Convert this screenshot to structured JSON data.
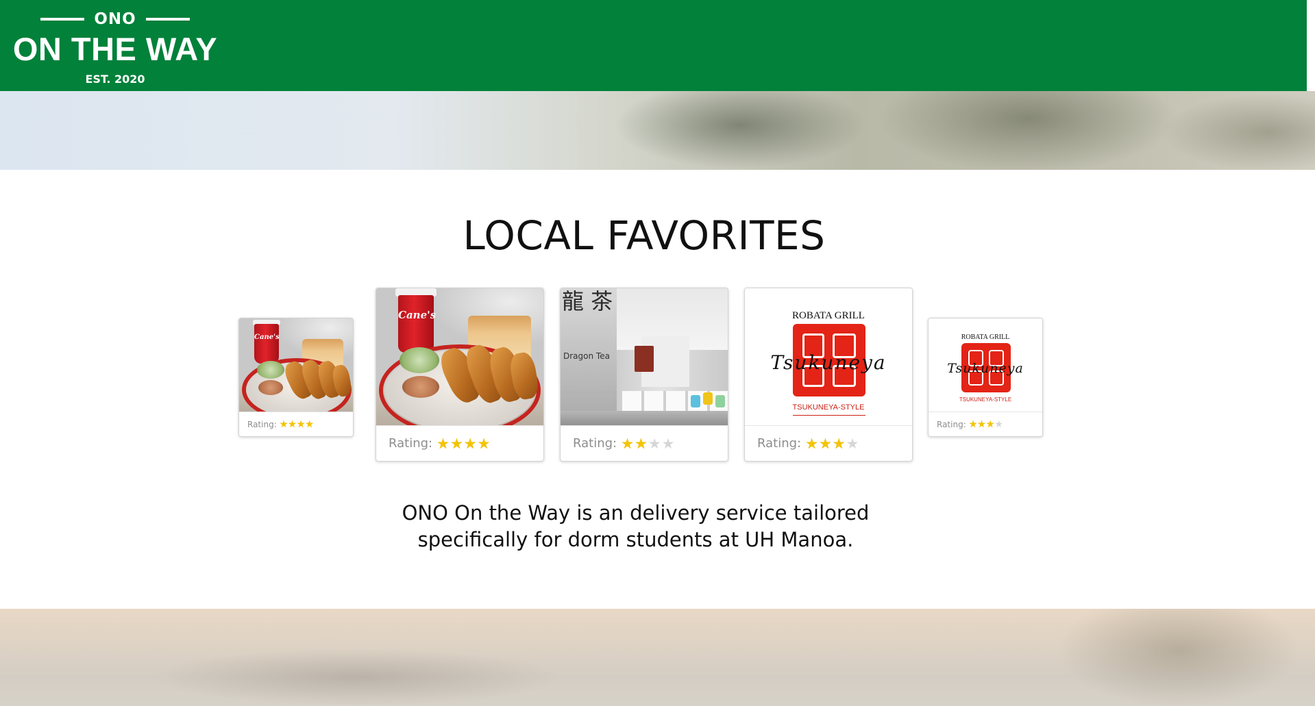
{
  "header": {
    "logo_top": "ONO",
    "logo_main": "ON THE WAY",
    "logo_est": "EST. 2020",
    "background": "#01813a"
  },
  "main": {
    "title": "LOCAL FAVORITES",
    "tagline_line1": "ONO On the Way is an delivery service tailored",
    "tagline_line2": "specifically for dorm students at UH Manoa."
  },
  "carousel": {
    "rating_label": "Rating:",
    "cards": [
      {
        "restaurant": "Raising Cane's",
        "image": "canes-food-photo",
        "cup_text": "Cane's",
        "rating": 4,
        "max": 4,
        "size": "small"
      },
      {
        "restaurant": "Raising Cane's",
        "image": "canes-food-photo",
        "cup_text": "Cane's",
        "rating": 4,
        "max": 4,
        "size": "big"
      },
      {
        "restaurant": "Dragon Tea",
        "image": "dragon-tea-interior",
        "kanji": "龍 茶",
        "brand_text": "Dragon Tea",
        "rating": 2,
        "max": 4,
        "size": "big"
      },
      {
        "restaurant": "Tsukuneya",
        "image": "tsukuneya-logo",
        "top_text": "ROBATA GRILL",
        "script_text": "Tsukuneya",
        "bottom_text": "TSUKUNEYA-STYLE",
        "rating": 3,
        "max": 4,
        "size": "big"
      },
      {
        "restaurant": "Tsukuneya",
        "image": "tsukuneya-logo",
        "top_text": "ROBATA GRILL",
        "script_text": "Tsukuneya",
        "bottom_text": "TSUKUNEYA-STYLE",
        "rating": 3,
        "max": 4,
        "size": "small"
      }
    ]
  },
  "colors": {
    "star_on": "#f4c400",
    "star_off": "#d6d6d6",
    "seal_red": "#e32416"
  }
}
